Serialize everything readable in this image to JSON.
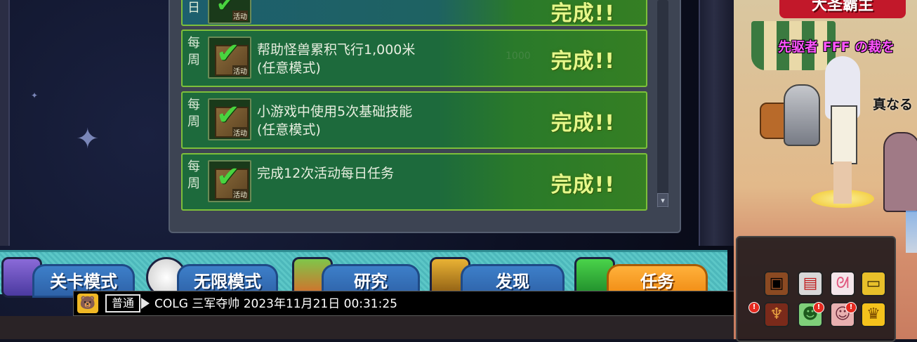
{
  "quest_panel": {
    "quests": [
      {
        "tag": "日",
        "title_line1": "",
        "title_line2": "",
        "progress": "",
        "status": "完成!!"
      },
      {
        "tag": "每周",
        "title_line1": "帮助怪兽累积飞行1,000米",
        "title_line2": "(任意模式)",
        "progress": "1000",
        "status": "完成!!"
      },
      {
        "tag": "每周",
        "title_line1": "小游戏中使用5次基础技能",
        "title_line2": "(任意模式)",
        "progress": "",
        "status": "完成!!"
      },
      {
        "tag": "每周",
        "title_line1": "完成12次活动每日任务",
        "title_line2": "",
        "progress": "",
        "status": "完成!!"
      }
    ],
    "icon_stamp": "活动",
    "scroll_down": "▾"
  },
  "menu": {
    "tabs": [
      {
        "label": "关卡模式",
        "active": false
      },
      {
        "label": "无限模式",
        "active": false
      },
      {
        "label": "研究",
        "active": false
      },
      {
        "label": "发现",
        "active": false
      },
      {
        "label": "任务",
        "active": true
      }
    ]
  },
  "chat": {
    "channel": "普通",
    "message": "COLG 三军夺帅 2023年11月21日 00:31:25",
    "emote": "🐻"
  },
  "scene": {
    "banner": "大圣霸主",
    "player_name": "先驱者 FFF の裁を",
    "other_name": "真なる"
  },
  "colors": {
    "complete_text": "#e6f78a",
    "row_border": "#7dbf3a",
    "menu_tab": "#2e62a8",
    "menu_tab_active": "#f08a12",
    "player_name": "#ff55ff"
  },
  "icons": [
    "bear-emote-icon",
    "crate-icon",
    "vending-machine-icon",
    "rabbit-icon",
    "bus-icon",
    "demon-icon",
    "green-creature-icon",
    "girl-face-icon",
    "crown-icon"
  ]
}
